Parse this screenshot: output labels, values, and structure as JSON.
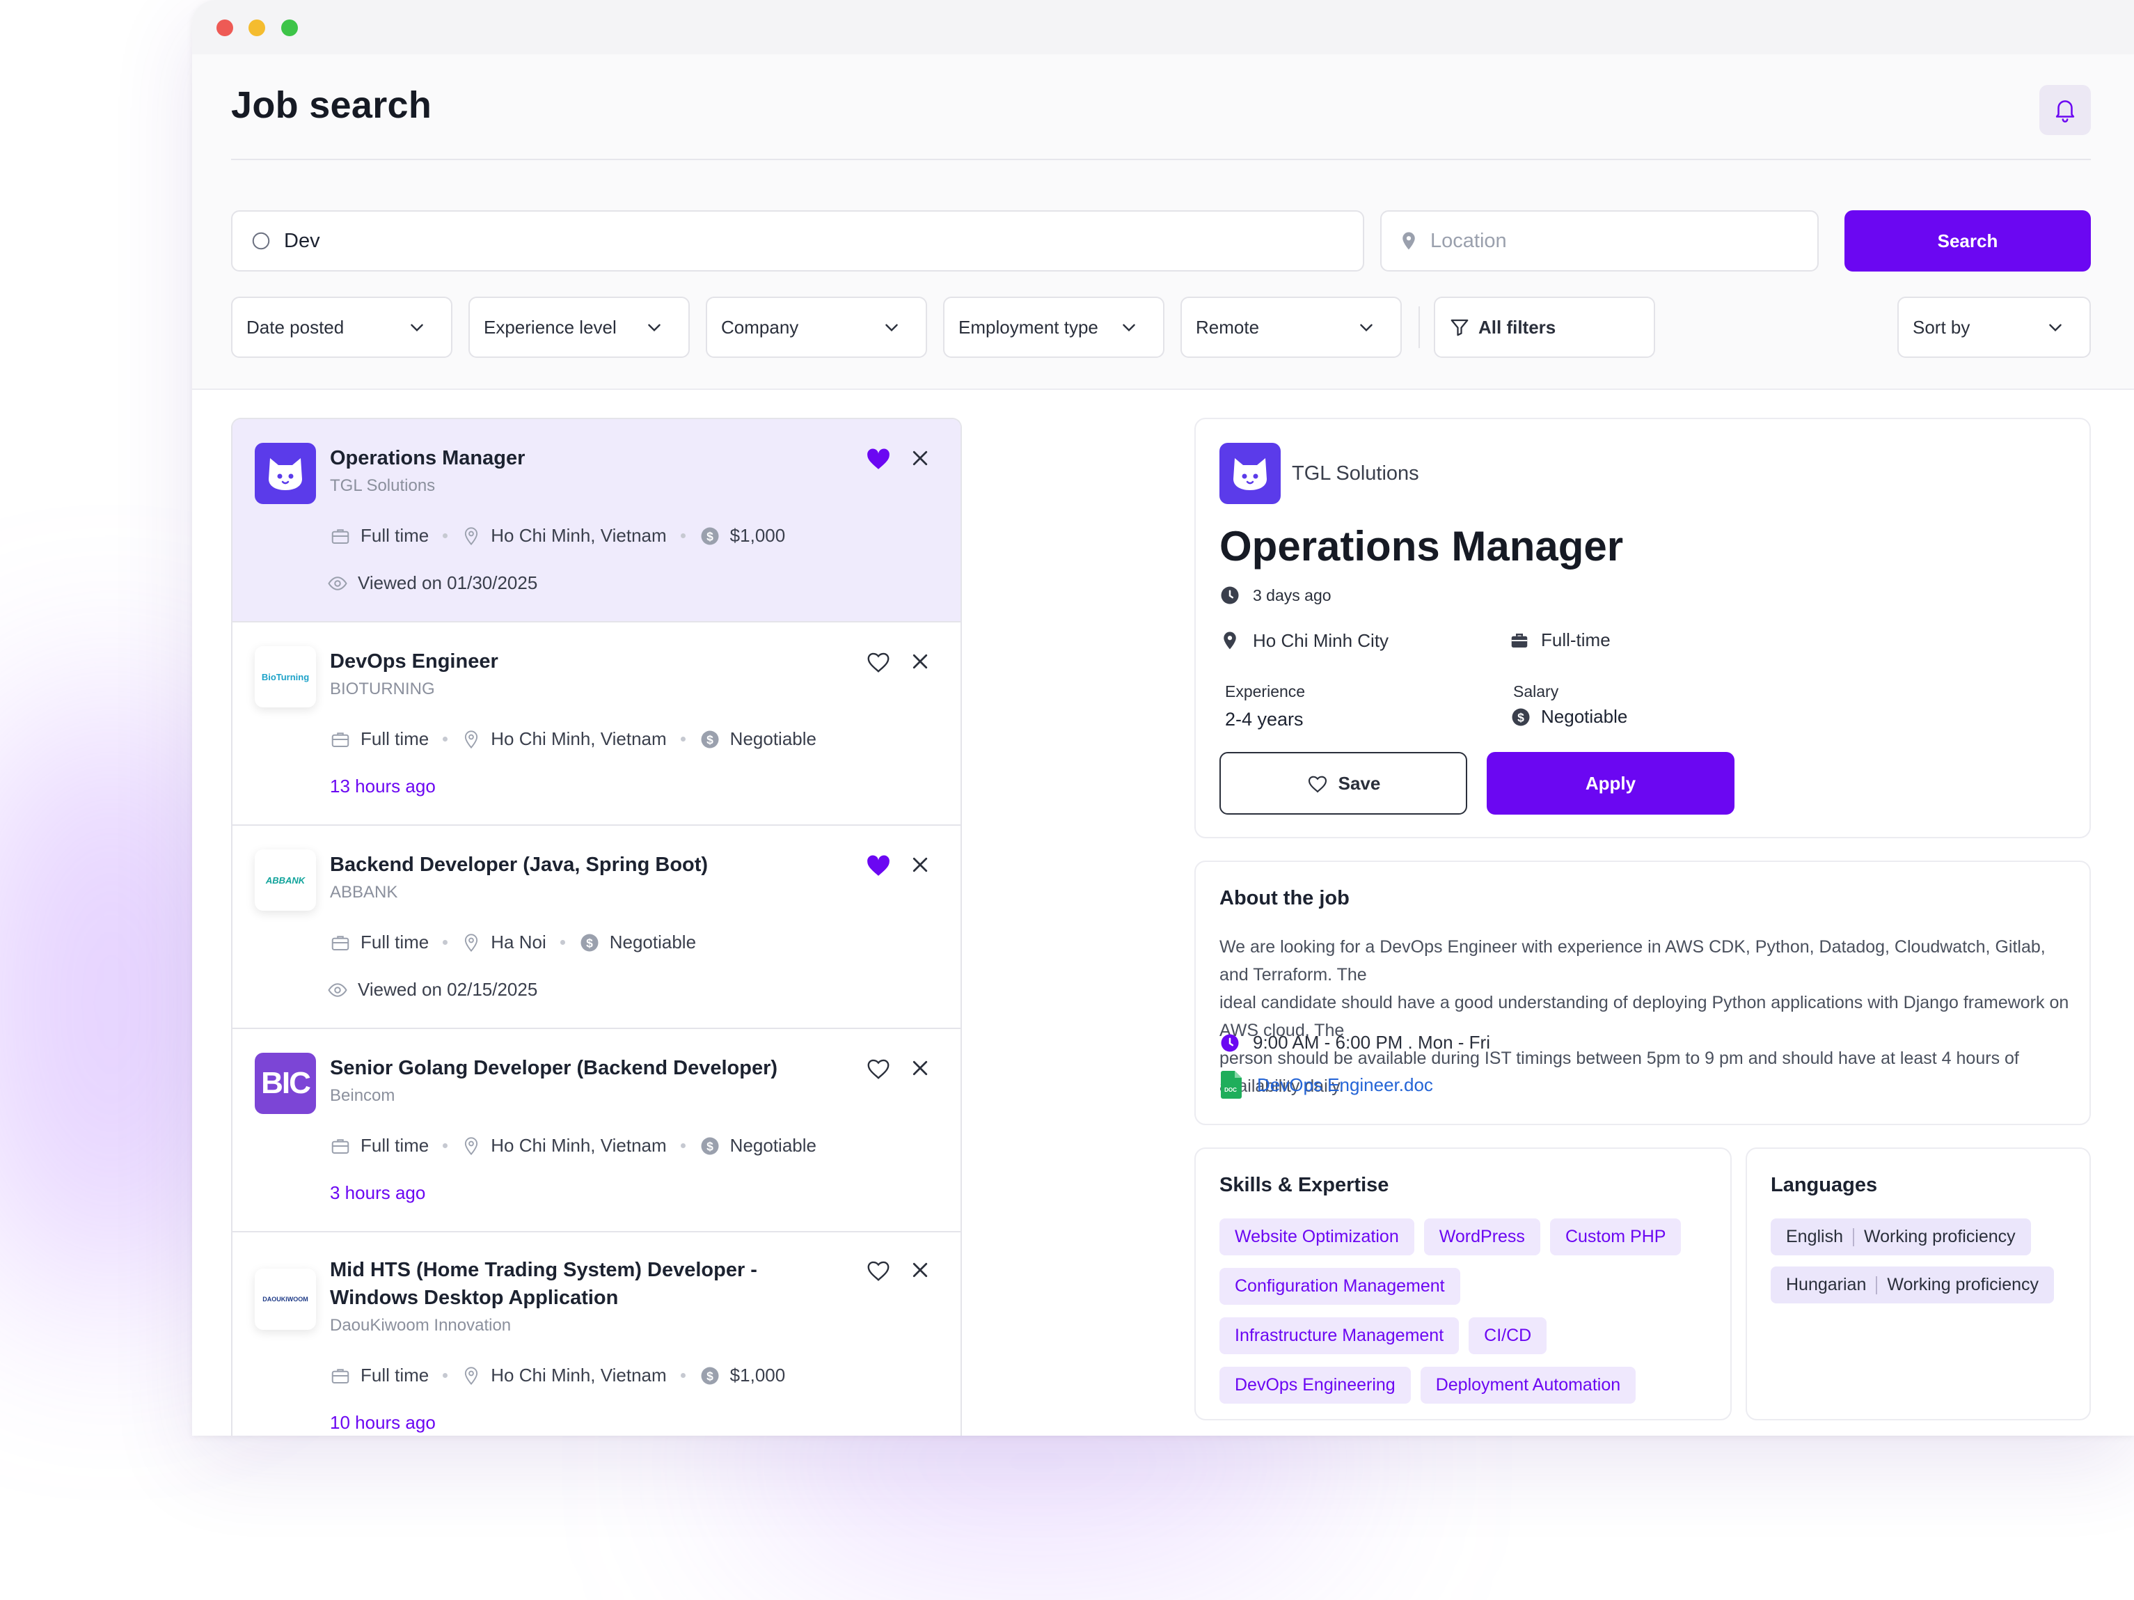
{
  "header": {
    "title": "Job search",
    "search_value": "Dev",
    "location_placeholder": "Location",
    "search_button": "Search",
    "filters": [
      "Date posted",
      "Experience level",
      "Company",
      "Employment type",
      "Remote"
    ],
    "all_filters": "All filters",
    "sort_by": "Sort by"
  },
  "jobs": [
    {
      "title": "Operations Manager",
      "company": "TGL Solutions",
      "type": "Full time",
      "location": "Ho Chi Minh, Vietnam",
      "salary": "$1,000",
      "status": "Viewed on 01/30/2025",
      "saved": true,
      "active": true
    },
    {
      "title": "DevOps Engineer",
      "company": "BIOTURNING",
      "logo_text": "BioTurning",
      "type": "Full time",
      "location": "Ho Chi Minh, Vietnam",
      "salary": "Negotiable",
      "status": "13 hours ago",
      "saved": false
    },
    {
      "title": "Backend Developer (Java, Spring Boot)",
      "company": "ABBANK",
      "logo_text": "ABBANK",
      "type": "Full time",
      "location": "Ha Noi",
      "salary": "Negotiable",
      "status": "Viewed on 02/15/2025",
      "saved": true
    },
    {
      "title": "Senior Golang Developer (Backend Developer)",
      "company": "Beincom",
      "logo_text": "BIC",
      "type": "Full time",
      "location": "Ho Chi Minh, Vietnam",
      "salary": "Negotiable",
      "status": "3 hours ago",
      "saved": false
    },
    {
      "title": "Mid HTS (Home Trading System) Developer - Windows Desktop Application",
      "company": "DaouKiwoom Innovation",
      "logo_text": "DAOUKIWOOM",
      "type": "Full time",
      "location": "Ho Chi Minh, Vietnam",
      "salary": "$1,000",
      "status": "10 hours ago",
      "saved": false
    }
  ],
  "detail": {
    "company": "TGL Solutions",
    "title": "Operations Manager",
    "posted": "3 days ago",
    "location": "Ho Chi Minh City",
    "employment": "Full-time",
    "experience_label": "Experience",
    "experience_value": "2-4 years",
    "salary_label": "Salary",
    "salary_value": "Negotiable",
    "save_button": "Save",
    "apply_button": "Apply"
  },
  "about": {
    "title": "About the job",
    "lines": [
      "We are looking for a DevOps Engineer with experience in AWS CDK, Python, Datadog, Cloudwatch, Gitlab, and Terraform. The",
      "ideal candidate should have a good understanding of deploying Python applications with Django framework on AWS cloud. The",
      "person should be available during IST timings between 5pm to 9 pm and should have at least 4 hours of availability daily."
    ],
    "hours": "9:00 AM - 6:00 PM . Mon - Fri",
    "attachment": "DevOps Engineer.doc",
    "attachment_icon_text": "DOC"
  },
  "skills": {
    "title": "Skills & Expertise",
    "items": [
      "Website Optimization",
      "WordPress",
      "Custom PHP",
      "Configuration Management",
      "Infrastructure Management",
      "CI/CD",
      "DevOps Engineering",
      "Deployment Automation"
    ]
  },
  "languages": {
    "title": "Languages",
    "items": [
      {
        "name": "English",
        "level": "Working proficiency"
      },
      {
        "name": "Hungarian",
        "level": "Working proficiency"
      }
    ]
  },
  "colors": {
    "accent": "#6b07f2",
    "active_card": "#efebfc",
    "chip_bg": "#efe8fd",
    "brand_logo": "#5b3bea"
  },
  "icons": [
    "bell-icon",
    "search-icon",
    "location-pin-icon",
    "chevron-down-icon",
    "filter-icon",
    "heart-icon",
    "close-icon",
    "briefcase-icon",
    "dollar-icon",
    "eye-icon",
    "clock-icon",
    "document-icon"
  ]
}
